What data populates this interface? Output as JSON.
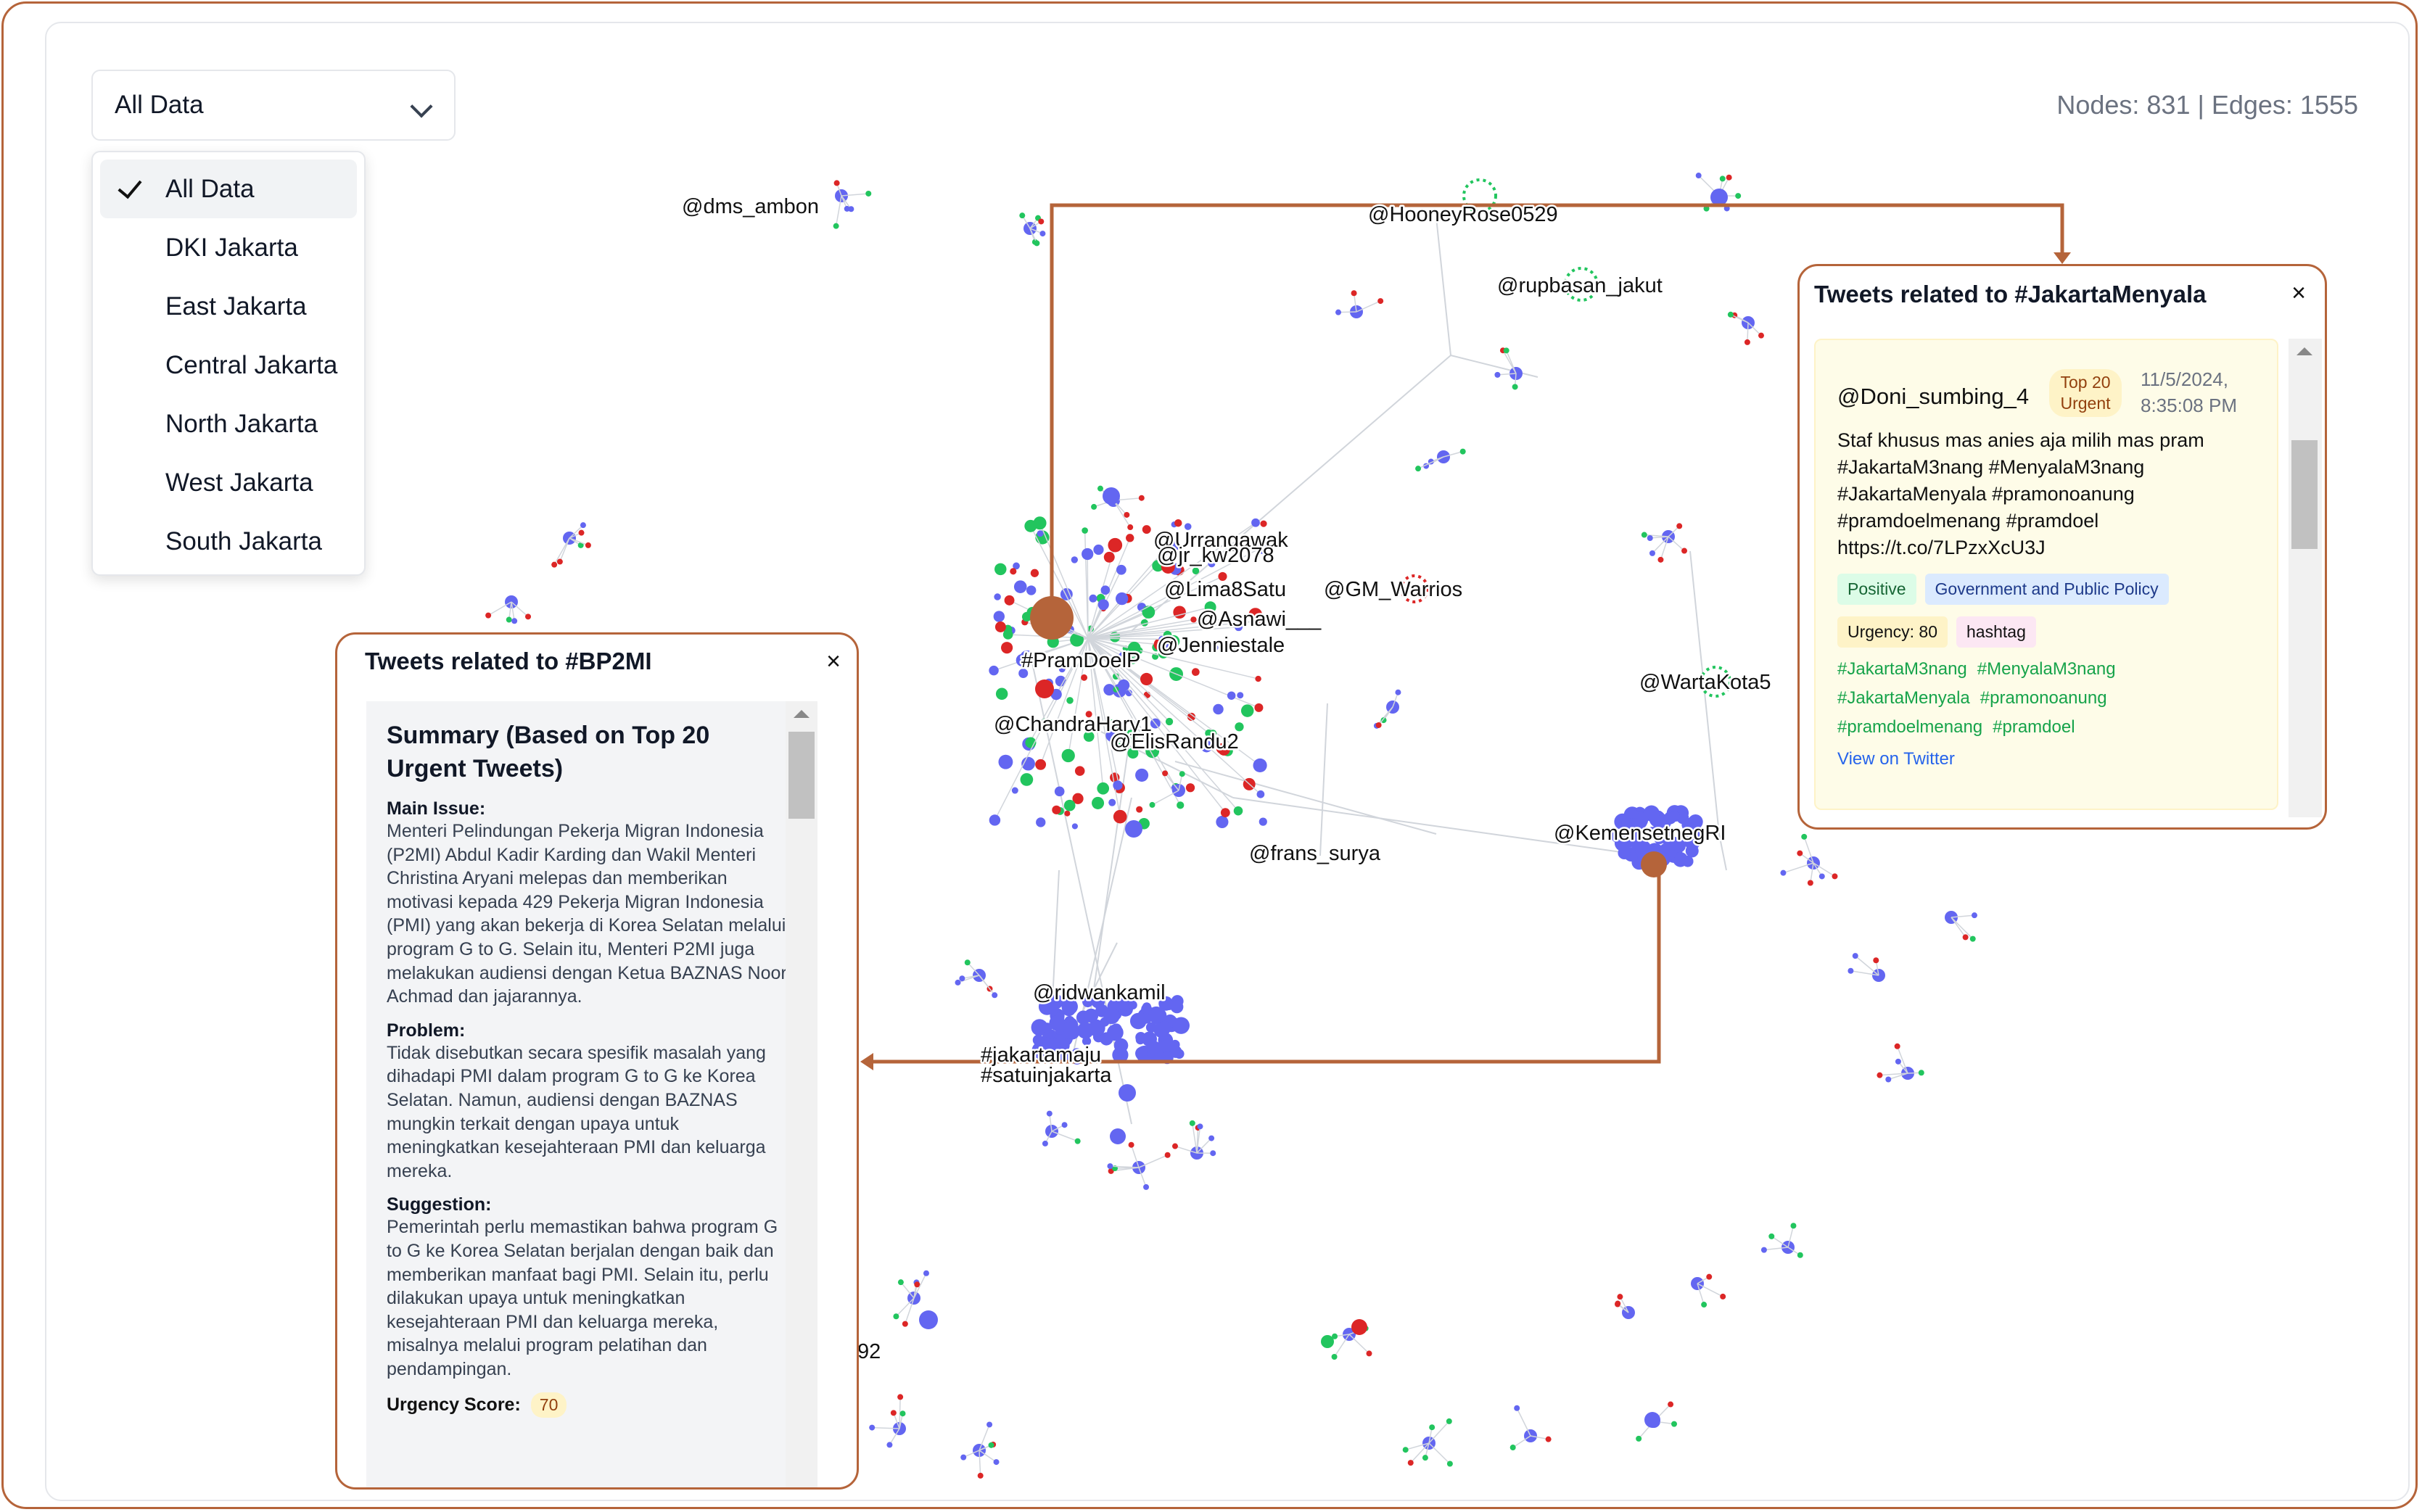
{
  "filter": {
    "selected": "All Data",
    "options": [
      "All Data",
      "DKI Jakarta",
      "East Jakarta",
      "Central Jakarta",
      "North Jakarta",
      "West Jakarta",
      "South Jakarta"
    ]
  },
  "stats": {
    "text": "Nodes: 831 | Edges: 1555"
  },
  "graph": {
    "labels": [
      "@dms_ambon",
      "@HooneyRose0529",
      "@rupbasan_jakut",
      "@Urrangawak",
      "@jr_kw2078",
      "@Lima8Satu",
      "@GM_Warrios",
      "@Asnawi___",
      "@Jenniestale",
      "#PramDoelP",
      "@ChandraHary1",
      "@ElisRandu2",
      "@WartaKota5",
      "@frans_surya",
      "@KemensetnegRI",
      "@ridwankamil",
      "#jakartamaju",
      "#satuinjakarta",
      "92"
    ],
    "colors": {
      "blue": "#6366f1",
      "red": "#dc2626",
      "green": "#22c55e",
      "highlight": "#b5643a",
      "edge": "#d1d5db"
    }
  },
  "panel_bp2mi": {
    "title": "Tweets related to #BP2MI",
    "close": "×",
    "summary_title": "Summary (Based on Top 20 Urgent Tweets)",
    "main_issue_label": "Main Issue:",
    "main_issue": "Menteri Pelindungan Pekerja Migran Indonesia (P2MI) Abdul Kadir Karding dan Wakil Menteri Christina Aryani melepas dan memberikan motivasi kepada 429 Pekerja Migran Indonesia (PMI) yang akan bekerja di Korea Selatan melalui program G to G. Selain itu, Menteri P2MI juga melakukan audiensi dengan Ketua BAZNAS Noor Achmad dan jajarannya.",
    "problem_label": "Problem:",
    "problem": "Tidak disebutkan secara spesifik masalah yang dihadapi PMI dalam program G to G ke Korea Selatan. Namun, audiensi dengan BAZNAS mungkin terkait dengan upaya untuk meningkatkan kesejahteraan PMI dan keluarga mereka.",
    "suggestion_label": "Suggestion:",
    "suggestion": "Pemerintah perlu memastikan bahwa program G to G ke Korea Selatan berjalan dengan baik dan memberikan manfaat bagi PMI. Selain itu, perlu dilakukan upaya untuk meningkatkan kesejahteraan PMI dan keluarga mereka, misalnya melalui program pelatihan dan pendampingan.",
    "urgency_label": "Urgency Score:",
    "urgency_value": "70"
  },
  "panel_jm": {
    "title": "Tweets related to #JakartaMenyala",
    "close": "×",
    "tweet": {
      "user": "@Doni_sumbing_4",
      "badge": "Top 20 Urgent",
      "date": "11/5/2024, 8:35:08 PM",
      "text": "Staf khusus mas anies aja milih mas pram #JakartaM3nang #MenyalaM3nang #JakartaMenyala #pramonoanung #pramdoelmenang #pramdoel https://t.co/7LPzxXcU3J",
      "sentiment": "Positive",
      "category": "Government and Public Policy",
      "urgency": "Urgency: 80",
      "type": "hashtag",
      "hashtags": [
        "#JakartaM3nang",
        "#MenyalaM3nang",
        "#JakartaMenyala",
        "#pramonoanung",
        "#pramdoelmenang",
        "#pramdoel"
      ],
      "link": "View on Twitter"
    }
  }
}
